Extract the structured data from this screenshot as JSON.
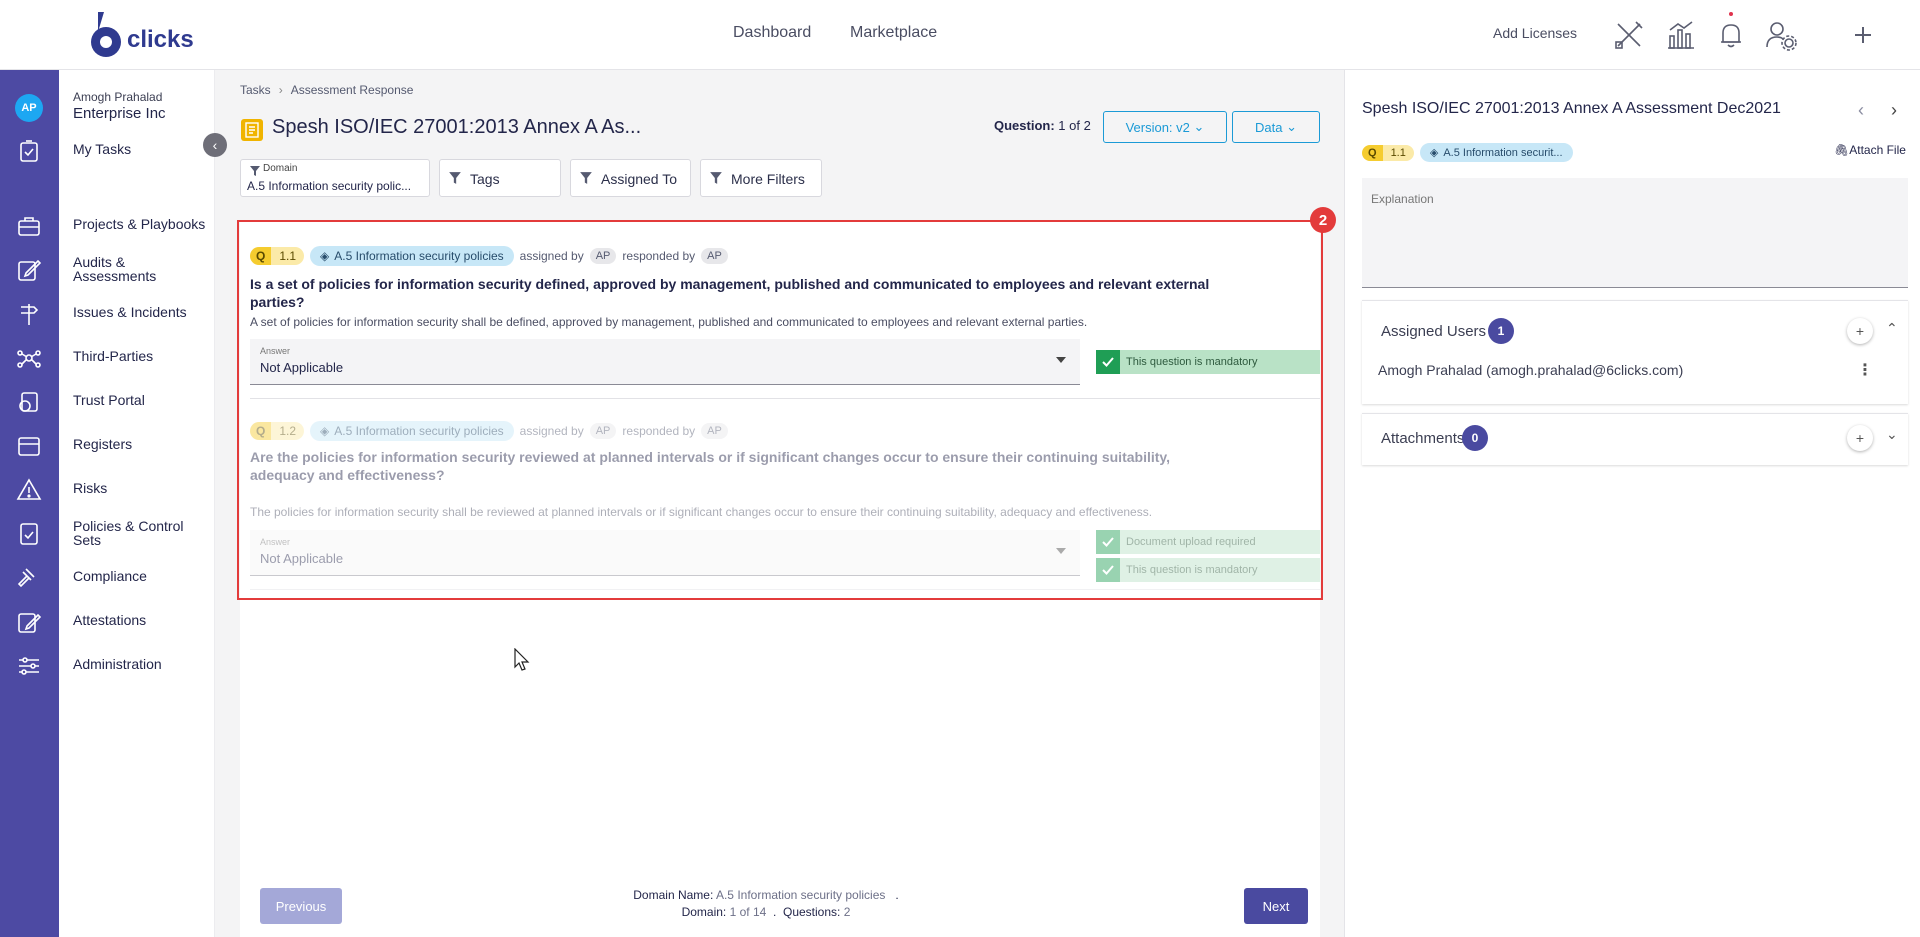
{
  "brand": {
    "logo_glyph": "6",
    "logo_text": "clicks",
    "brand_color": "#2f3a8f"
  },
  "topnav": {
    "dashboard": "Dashboard",
    "marketplace": "Marketplace",
    "add_licenses": "Add Licenses"
  },
  "user": {
    "initials": "AP",
    "name": "Amogh Prahalad",
    "org": "Enterprise Inc"
  },
  "menu": {
    "my_tasks": "My Tasks",
    "items": [
      "Projects & Playbooks",
      "Audits & Assessments",
      "Issues & Incidents",
      "Third-Parties",
      "Trust Portal",
      "Registers",
      "Risks",
      "Policies & Control Sets",
      "Compliance",
      "Attestations",
      "Administration"
    ]
  },
  "breadcrumb": {
    "tasks": "Tasks",
    "current": "Assessment Response"
  },
  "page": {
    "title": "Spesh ISO/IEC 27001:2013 Annex A As...",
    "question_label": "Question:",
    "question_pos": "1 of 2",
    "version_btn": "Version: v2",
    "data_btn": "Data"
  },
  "filters": {
    "domain_label": "Domain",
    "domain_value": "A.5 Information security polic...",
    "tags": "Tags",
    "assigned_to": "Assigned To",
    "more": "More Filters"
  },
  "highlight_badge": "2",
  "questions": [
    {
      "q": "Q",
      "num": "1.1",
      "domain": "A.5 Information security policies",
      "assigned_by": "assigned by",
      "assigned_ap": "AP",
      "responded_by": "responded by",
      "responded_ap": "AP",
      "title": "Is a set of policies for information security defined, approved by management, published and communicated to employees and relevant external parties?",
      "description": "A set of policies for information security shall be defined, approved by management, published and communicated to employees and relevant external parties.",
      "answer_label": "Answer",
      "answer_value": "Not Applicable",
      "flags": [
        "This question is mandatory"
      ]
    },
    {
      "q": "Q",
      "num": "1.2",
      "domain": "A.5 Information security policies",
      "assigned_by": "assigned by",
      "assigned_ap": "AP",
      "responded_by": "responded by",
      "responded_ap": "AP",
      "title": "Are the policies for information security reviewed at planned intervals or if significant changes occur to ensure their continuing suitability, adequacy and effectiveness?",
      "description": "The policies for information security shall be reviewed at planned intervals or if significant changes occur to ensure their continuing suitability, adequacy and effectiveness.",
      "answer_label": "Answer",
      "answer_value": "Not Applicable",
      "flags": [
        "Document upload required",
        "This question is mandatory"
      ]
    }
  ],
  "footer": {
    "previous": "Previous",
    "next": "Next",
    "domain_name_label": "Domain Name:",
    "domain_name": "A.5 Information security policies",
    "dot": ".",
    "domain_label": "Domain:",
    "domain_pos": "1 of 14",
    "questions_label": "Questions:",
    "questions_count": "2"
  },
  "right": {
    "title": "Spesh ISO/IEC 27001:2013 Annex A Assessment Dec2021",
    "q": "Q",
    "num": "1.1",
    "domain": "A.5 Information securit...",
    "attach": "Attach File",
    "explanation_placeholder": "Explanation",
    "assigned_users_label": "Assigned Users",
    "assigned_count": "1",
    "assigned_user": "Amogh Prahalad (amogh.prahalad@6clicks.com)",
    "attachments_label": "Attachments",
    "attachments_count": "0",
    "plus": "+"
  },
  "colors": {
    "rail": "#4d4aa3",
    "accent": "#1b9ad6",
    "highlight": "#e33b3b",
    "primary_button": "#4a4aa0",
    "mandatory": "#1f9e55"
  }
}
